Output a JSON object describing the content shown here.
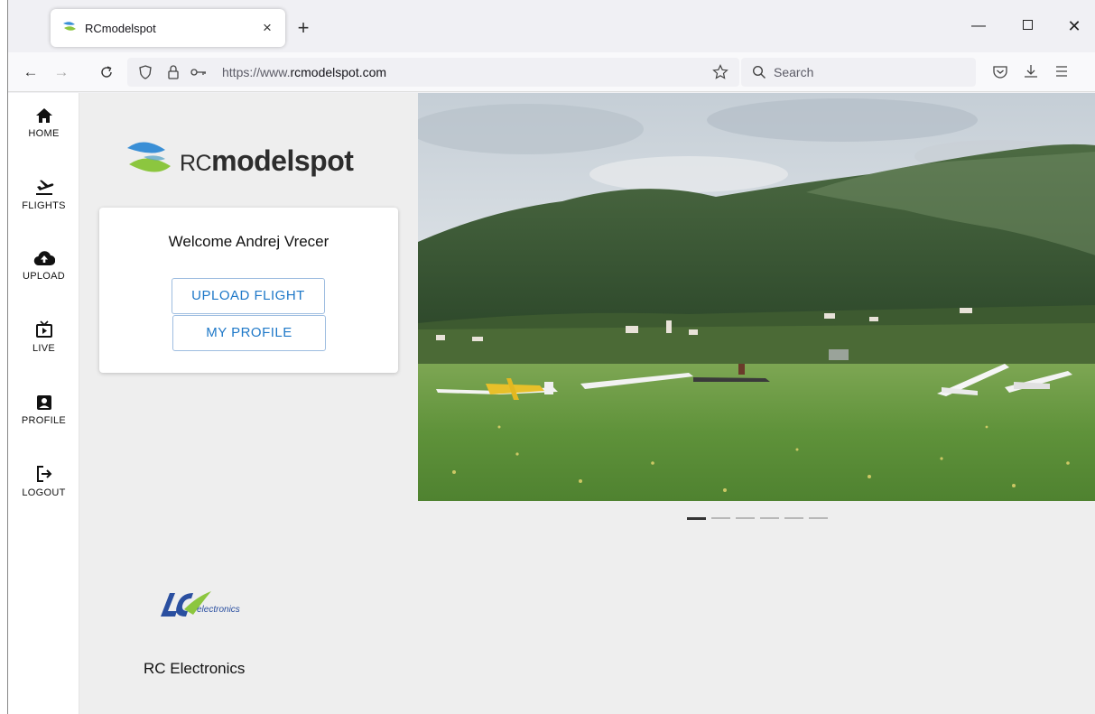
{
  "browser": {
    "tab_title": "RCmodelspot",
    "url_prefix": "https://www.",
    "url_domain": "rcmodelspot.com",
    "search_placeholder": "Search"
  },
  "sidebar": {
    "items": [
      {
        "label": "HOME",
        "icon": "home-icon"
      },
      {
        "label": "FLIGHTS",
        "icon": "airplane-icon"
      },
      {
        "label": "UPLOAD",
        "icon": "cloud-upload-icon"
      },
      {
        "label": "LIVE",
        "icon": "live-tv-icon"
      },
      {
        "label": "PROFILE",
        "icon": "profile-icon"
      },
      {
        "label": "LOGOUT",
        "icon": "logout-icon"
      }
    ]
  },
  "logo": {
    "rc": "RC",
    "modelspot": "modelspot"
  },
  "card": {
    "welcome": "Welcome Andrej Vrecer",
    "upload_button": "UPLOAD FLIGHT",
    "profile_button": "MY PROFILE"
  },
  "carousel": {
    "slide_count": 6,
    "active_index": 0
  },
  "sponsor": {
    "logo_text": "electronics",
    "name": "RC Electronics"
  },
  "colors": {
    "accent": "#1e78c8",
    "logo_blue": "#3a8fd6",
    "logo_green": "#8cc63f"
  }
}
